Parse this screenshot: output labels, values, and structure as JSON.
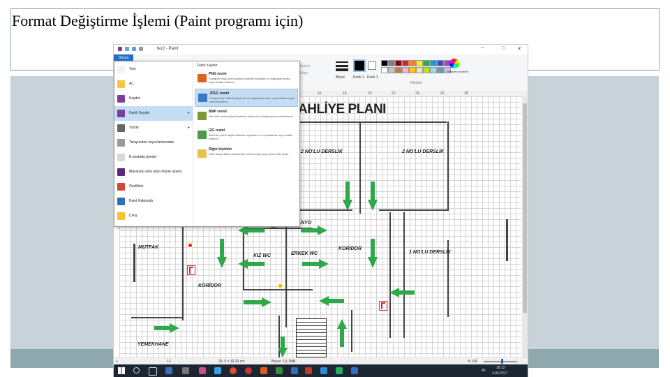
{
  "slide": {
    "title": "Format Değiştirme İşlemi (Paint programı için)"
  },
  "window": {
    "title": "tez2 - Paint",
    "file_tab": "Dosya",
    "controls": [
      "─",
      "□",
      "✕"
    ]
  },
  "ribbon": {
    "groups": {
      "outline": "Anahat",
      "fill": "Dolgu",
      "size": "Boyut",
      "color1": "Renk 1",
      "color2": "Renk 2",
      "colors": "Renkler",
      "edit_colors": "Renkleri düzenle"
    },
    "palette": [
      "#000000",
      "#7f7f7f",
      "#880015",
      "#ed1c24",
      "#ff7f27",
      "#fff200",
      "#22b14c",
      "#00a2e8",
      "#3f48cc",
      "#a349a4",
      "#ffffff",
      "#c3c3c3",
      "#b97a57",
      "#ffaec9",
      "#ffc90e",
      "#efe4b0",
      "#b5e61d",
      "#99d9ea",
      "#7092be",
      "#c8bfe7"
    ]
  },
  "ruler": {
    "ticks": [
      "16",
      "18",
      "20",
      "22",
      "24",
      "26",
      "28"
    ]
  },
  "file_menu": {
    "items": [
      {
        "label": "Yeni",
        "icon": "new-file-icon",
        "color": "#f2f2f2"
      },
      {
        "label": "Aç",
        "icon": "open-folder-icon",
        "color": "#f6c643"
      },
      {
        "label": "Kaydet",
        "icon": "save-icon",
        "color": "#7a3f9c"
      },
      {
        "label": "Farklı Kaydet",
        "icon": "save-as-icon",
        "color": "#7a3f9c"
      },
      {
        "label": "Yazdır",
        "icon": "print-icon",
        "color": "#666666"
      },
      {
        "label": "Tarayıcıdan veya kameradan",
        "icon": "scanner-icon",
        "color": "#999999"
      },
      {
        "label": "E-postada gönder",
        "icon": "email-icon",
        "color": "#d9d9d9"
      },
      {
        "label": "Masaüstü arka planı olarak ayarla",
        "icon": "desktop-icon",
        "color": "#5a2a82"
      },
      {
        "label": "Özellikler",
        "icon": "properties-check-icon",
        "color": "#d6453c"
      },
      {
        "label": "Paint Hakkında",
        "icon": "info-icon",
        "color": "#2f6fbd"
      },
      {
        "label": "Çıkış",
        "icon": "exit-icon",
        "color": "#f1c232"
      }
    ],
    "submenu_heading": "Farklı Kaydet",
    "options": [
      {
        "name": "PNG resmi",
        "desc": "Fotoğrafı veya çizimi yüksek kalitede kaydedin ve bilgisayarınızda veya webde kullanın.",
        "icon": "png-icon",
        "color": "#d8641f"
      },
      {
        "name": "JPEG resmi",
        "desc": "Fotoğrafı iyi kalitede kaydedin ve bilgisayarınızda, e-postalarda veya webde kullanın.",
        "icon": "jpeg-icon",
        "color": "#3a78c2"
      },
      {
        "name": "BMP resmi",
        "desc": "Her türlü resmi yüksek kalitede kaydedin ve bilgisayarınızda kullanın.",
        "icon": "bmp-icon",
        "color": "#7a9a3a"
      },
      {
        "name": "GIF resmi",
        "desc": "Basit bir çizimi düşük kalitede kaydedin ve e-postalarda veya webde kullanın.",
        "icon": "gif-icon",
        "color": "#4a9a4a"
      },
      {
        "name": "Diğer biçimler",
        "desc": "Sizin dosya listesi kaydetmek üzere dosya veya resim türü seçin.",
        "icon": "other-formats-icon",
        "color": "#e8c04a"
      }
    ]
  },
  "floor_plan": {
    "title": "AHLİYE PLANI",
    "rooms": {
      "derslik2_a": "2 NO'LU DERSLİK",
      "derslik2_b": "2 NO'LU DERSLİK",
      "banyo": "BANYO",
      "wc": "WC",
      "mutfak": "MUTFAK",
      "kiz_wc": "KIZ WC",
      "erkek_wc": "ERKEK WC",
      "koridor_right": "KORİDOR",
      "derslik1": "1 NO'LU DERSLİK",
      "koridor_left": "KORİDOR",
      "yemekhane": "YEMEKHANE"
    }
  },
  "statusbar": {
    "position": "12",
    "selection": "29, 5 × 32,33 cm",
    "size": "Boyut: 2,5,7MB",
    "zoom": "% 100"
  },
  "taskbar": {
    "temperature": "40",
    "time": "16:12",
    "date": "4.04.2017"
  }
}
